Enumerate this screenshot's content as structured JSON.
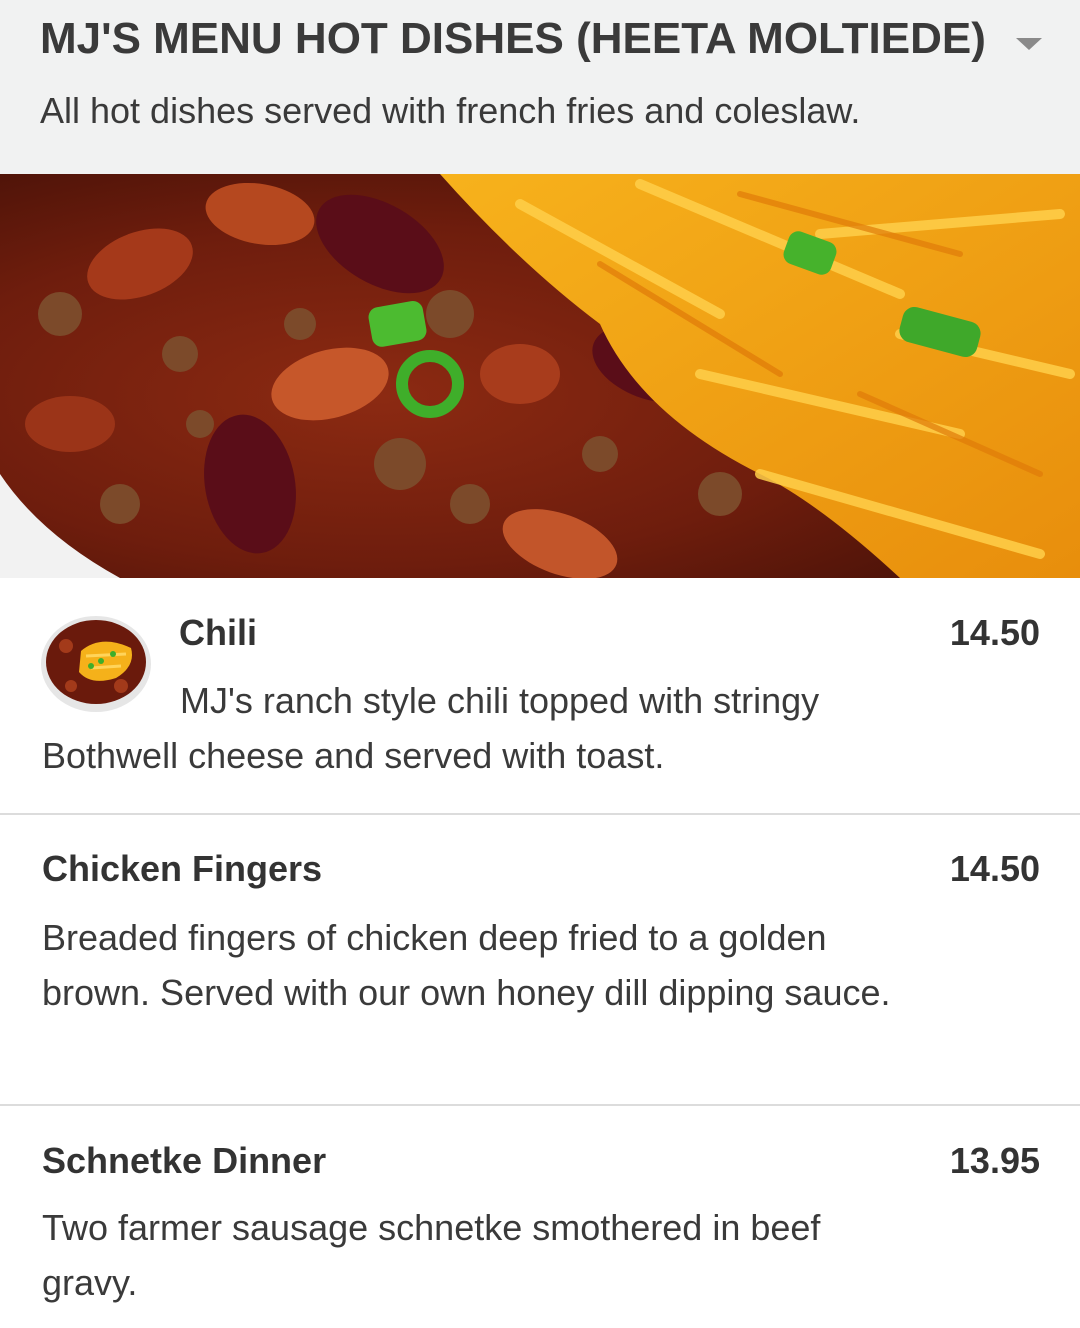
{
  "section": {
    "title": "MJ'S MENU HOT DISHES (HEETA MOLTIEDE)",
    "subtitle": "All hot dishes served with french fries and coleslaw.",
    "toggle_icon": "chevron-down-icon"
  },
  "colors": {
    "header_bg": "#f1f2f2",
    "text": "#333333",
    "divider": "#dcdcdc"
  },
  "items": [
    {
      "name": "Chili",
      "price": "14.50",
      "description": "MJ's ranch style chili topped with stringy Bothwell cheese and served with toast."
    },
    {
      "name": "Chicken Fingers",
      "price": "14.50",
      "description": "Breaded fingers of chicken deep fried to a golden brown. Served with our own honey dill dipping sauce."
    },
    {
      "name": "Schnetke Dinner",
      "price": "13.95",
      "description": "Two farmer sausage schnetke smothered in beef gravy."
    }
  ]
}
